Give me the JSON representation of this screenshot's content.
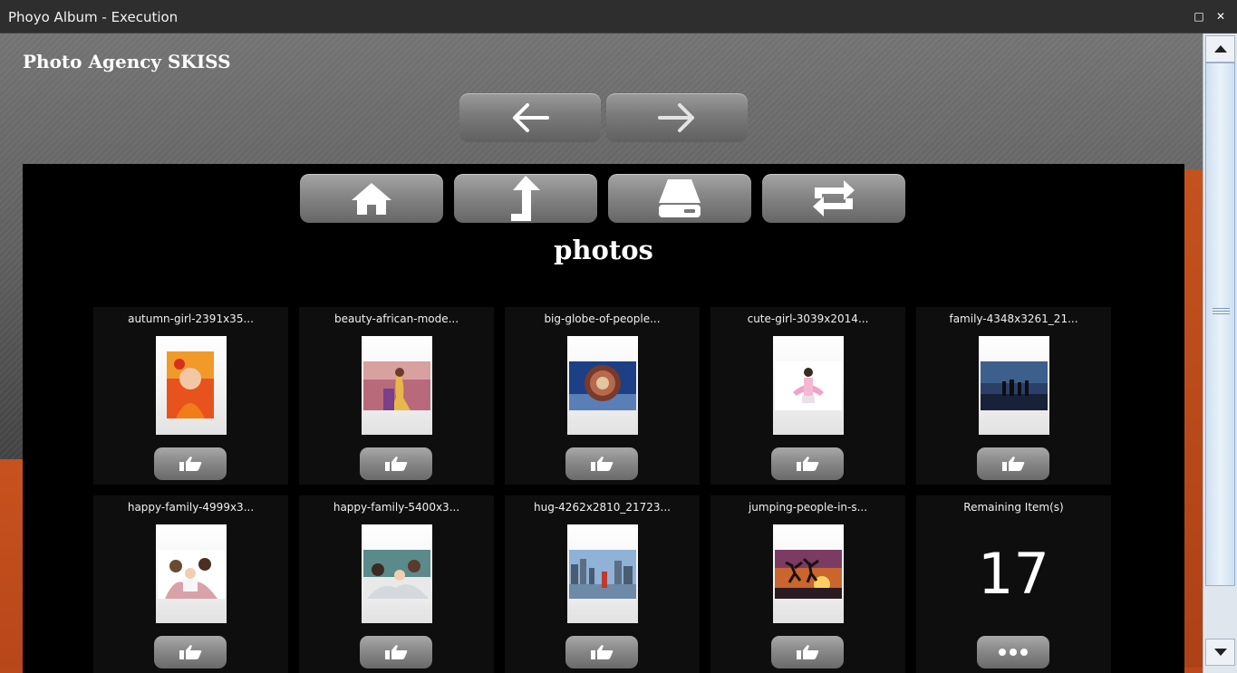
{
  "window": {
    "title": "Phoyo Album - Execution",
    "maximize_glyph": "□",
    "close_glyph": "✕"
  },
  "app": {
    "title": "Photo Agency SKISS"
  },
  "nav": {
    "back_icon": "arrow-left-icon",
    "forward_icon": "arrow-right-icon"
  },
  "toolbar": {
    "icons": [
      "home-icon",
      "parent-folder-icon",
      "drive-icon",
      "sync-icon"
    ]
  },
  "folder": {
    "title": "photos"
  },
  "photos": [
    {
      "name": "autumn-girl-2391x35..."
    },
    {
      "name": "beauty-african-mode..."
    },
    {
      "name": "big-globe-of-people..."
    },
    {
      "name": "cute-girl-3039x2014..."
    },
    {
      "name": "family-4348x3261_21..."
    },
    {
      "name": "happy-family-4999x3..."
    },
    {
      "name": "happy-family-5400x3..."
    },
    {
      "name": "hug-4262x2810_21723..."
    },
    {
      "name": "jumping-people-in-s..."
    }
  ],
  "remaining": {
    "label": "Remaining Item(s)",
    "count": "17",
    "more_icon": "more-dots-icon"
  },
  "colors": {
    "accent_orange": "#c4521e",
    "panel_bg": "#000000"
  }
}
